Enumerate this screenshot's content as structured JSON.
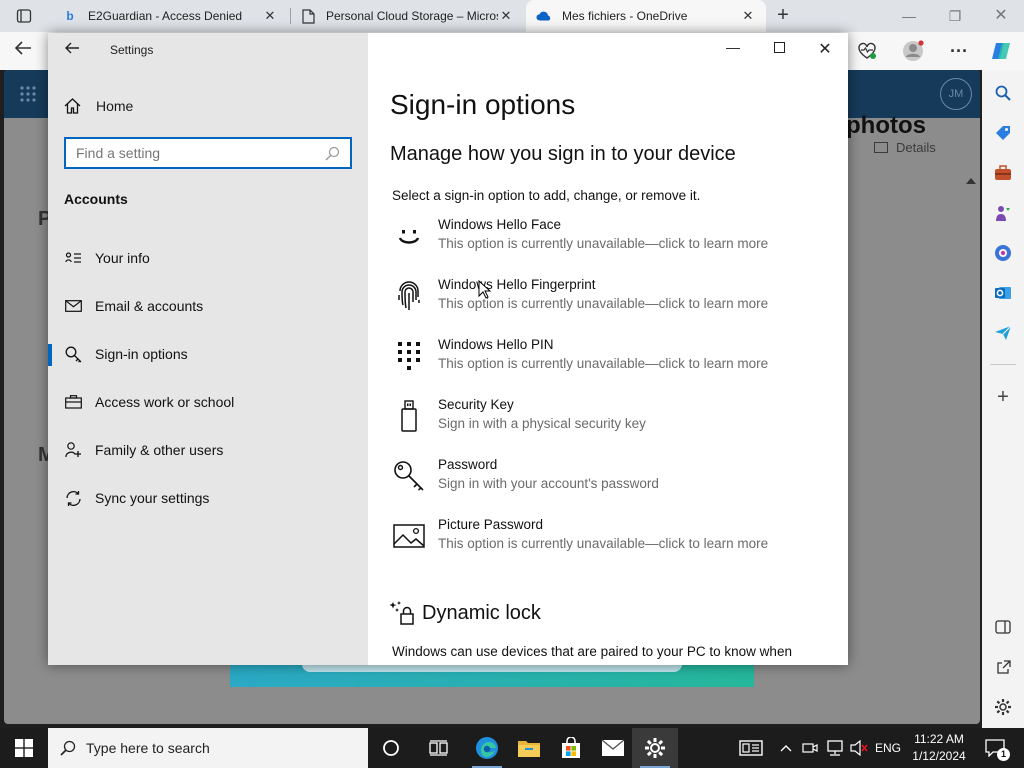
{
  "browser": {
    "tabs": [
      {
        "label": "E2Guardian - Access Denied",
        "icon": "bing-icon"
      },
      {
        "label": "Personal Cloud Storage – Microsoft",
        "icon": "document-icon"
      },
      {
        "label": "Mes fichiers - OneDrive",
        "icon": "onedrive-icon",
        "active": true
      }
    ],
    "close_glyph": "✕",
    "new_tab_glyph": "+"
  },
  "onedrive_bg": {
    "title_fragment": "photos",
    "details_label": "Details",
    "letter_1": "P",
    "letter_2": "M",
    "avatar_initials": "JM"
  },
  "settings": {
    "window_title": "Settings",
    "home_label": "Home",
    "search_placeholder": "Find a setting",
    "section_label": "Accounts",
    "nav_items": [
      {
        "label": "Your info",
        "icon": "person-card-icon"
      },
      {
        "label": "Email & accounts",
        "icon": "mail-icon"
      },
      {
        "label": "Sign-in options",
        "icon": "key-icon",
        "selected": true
      },
      {
        "label": "Access work or school",
        "icon": "briefcase-icon"
      },
      {
        "label": "Family & other users",
        "icon": "person-add-icon"
      },
      {
        "label": "Sync your settings",
        "icon": "sync-icon"
      }
    ],
    "page_title": "Sign-in options",
    "subtitle": "Manage how you sign in to your device",
    "intro": "Select a sign-in option to add, change, or remove it.",
    "options": [
      {
        "title": "Windows Hello Face",
        "desc": "This option is currently unavailable—click to learn more",
        "icon": "face-icon"
      },
      {
        "title": "Windows Hello Fingerprint",
        "desc": "This option is currently unavailable—click to learn more",
        "icon": "fingerprint-icon"
      },
      {
        "title": "Windows Hello PIN",
        "desc": "This option is currently unavailable—click to learn more",
        "icon": "pin-keypad-icon"
      },
      {
        "title": "Security Key",
        "desc": "Sign in with a physical security key",
        "icon": "usb-key-icon"
      },
      {
        "title": "Password",
        "desc": "Sign in with your account's password",
        "icon": "password-key-icon"
      },
      {
        "title": "Picture Password",
        "desc": "This option is currently unavailable—click to learn more",
        "icon": "picture-icon"
      }
    ],
    "dynamic_lock_title": "Dynamic lock",
    "dynamic_lock_text": "Windows can use devices that are paired to your PC to know when"
  },
  "taskbar": {
    "search_placeholder": "Type here to search",
    "language": "ENG",
    "time": "11:22 AM",
    "date": "1/12/2024",
    "notification_count": "1"
  },
  "colors": {
    "accent": "#0067c0",
    "nav_bg": "#e6e6e6",
    "taskbar_bg": "#1c1c1c"
  }
}
